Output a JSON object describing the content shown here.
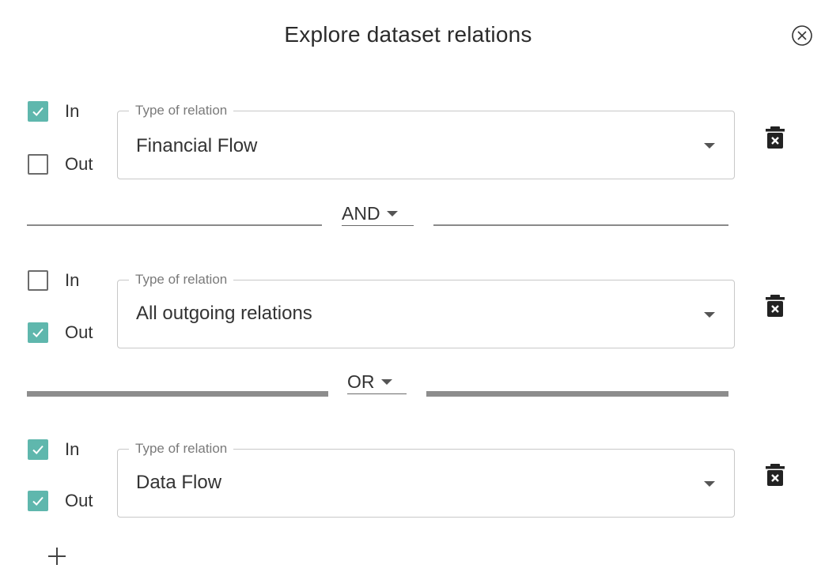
{
  "dialog": {
    "title": "Explore dataset relations",
    "close_icon": "close-circle-icon"
  },
  "rules": [
    {
      "in": {
        "label": "In",
        "checked": true
      },
      "out": {
        "label": "Out",
        "checked": false
      },
      "relation": {
        "legend": "Type of relation",
        "value": "Financial Flow"
      },
      "delete_icon": "trash-icon"
    },
    {
      "in": {
        "label": "In",
        "checked": false
      },
      "out": {
        "label": "Out",
        "checked": true
      },
      "relation": {
        "legend": "Type of relation",
        "value": "All outgoing relations"
      },
      "delete_icon": "trash-icon"
    },
    {
      "in": {
        "label": "In",
        "checked": true
      },
      "out": {
        "label": "Out",
        "checked": true
      },
      "relation": {
        "legend": "Type of relation",
        "value": "Data Flow"
      },
      "delete_icon": "trash-icon"
    }
  ],
  "operators": [
    {
      "value": "AND"
    },
    {
      "value": "OR"
    }
  ],
  "add_icon": "plus-icon",
  "colors": {
    "checkbox_checked": "#5fb7ad",
    "divider": "#8a8a8a",
    "text": "#333333"
  }
}
